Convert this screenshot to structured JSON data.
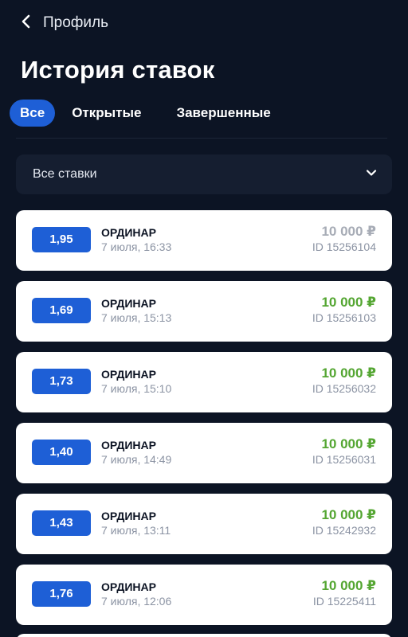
{
  "header": {
    "back_label": "Профиль",
    "title": "История ставок"
  },
  "tabs": [
    {
      "label": "Все",
      "active": true
    },
    {
      "label": "Открытые",
      "active": false
    },
    {
      "label": "Завершенные",
      "active": false
    }
  ],
  "filter": {
    "label": "Все ставки",
    "icon": "chevron-down-icon"
  },
  "bets": [
    {
      "odds": "1,95",
      "type": "ОРДИНАР",
      "date": "7 июля, 16:33",
      "amount": "10 000 ₽",
      "id": "ID 15256104",
      "status": "pending"
    },
    {
      "odds": "1,69",
      "type": "ОРДИНАР",
      "date": "7 июля, 15:13",
      "amount": "10 000 ₽",
      "id": "ID 15256103",
      "status": "won"
    },
    {
      "odds": "1,73",
      "type": "ОРДИНАР",
      "date": "7 июля, 15:10",
      "amount": "10 000 ₽",
      "id": "ID 15256032",
      "status": "won"
    },
    {
      "odds": "1,40",
      "type": "ОРДИНАР",
      "date": "7 июля, 14:49",
      "amount": "10 000 ₽",
      "id": "ID 15256031",
      "status": "won"
    },
    {
      "odds": "1,43",
      "type": "ОРДИНАР",
      "date": "7 июля, 13:11",
      "amount": "10 000 ₽",
      "id": "ID 15242932",
      "status": "won"
    },
    {
      "odds": "1,76",
      "type": "ОРДИНАР",
      "date": "7 июля, 12:06",
      "amount": "10 000 ₽",
      "id": "ID 15225411",
      "status": "won"
    }
  ],
  "colors": {
    "background": "#0c1424",
    "accent": "#1e5fd6",
    "won_amount": "#54a632",
    "pending_amount": "#a7acb6"
  }
}
